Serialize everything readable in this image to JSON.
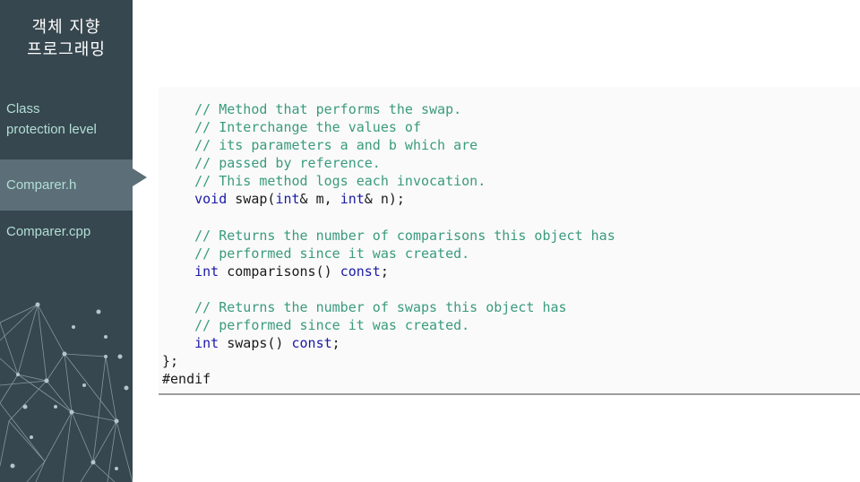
{
  "sidebar": {
    "title_lines": [
      "객체 지향",
      "프로그래밍"
    ],
    "nav": [
      {
        "lines": [
          "Class",
          "protection level"
        ],
        "active": false
      },
      {
        "lines": [
          "Comparer.h"
        ],
        "active": true
      },
      {
        "lines": [
          "Comparer.cpp"
        ],
        "active": false
      }
    ]
  },
  "code": {
    "language": "C++",
    "lines": [
      [
        {
          "t": "    "
        },
        {
          "t": "// Method that performs the swap.",
          "c": "comment"
        }
      ],
      [
        {
          "t": "    "
        },
        {
          "t": "// Interchange the values of",
          "c": "comment"
        }
      ],
      [
        {
          "t": "    "
        },
        {
          "t": "// its parameters a and b which are",
          "c": "comment"
        }
      ],
      [
        {
          "t": "    "
        },
        {
          "t": "// passed by reference.",
          "c": "comment"
        }
      ],
      [
        {
          "t": "    "
        },
        {
          "t": "// This method logs each invocation.",
          "c": "comment"
        }
      ],
      [
        {
          "t": "    "
        },
        {
          "t": "void",
          "c": "keyword"
        },
        {
          "t": " swap("
        },
        {
          "t": "int",
          "c": "keyword"
        },
        {
          "t": "& m, "
        },
        {
          "t": "int",
          "c": "keyword"
        },
        {
          "t": "& n);"
        }
      ],
      [
        {
          "t": ""
        }
      ],
      [
        {
          "t": "    "
        },
        {
          "t": "// Returns the number of comparisons this object has",
          "c": "comment"
        }
      ],
      [
        {
          "t": "    "
        },
        {
          "t": "// performed since it was created.",
          "c": "comment"
        }
      ],
      [
        {
          "t": "    "
        },
        {
          "t": "int",
          "c": "keyword"
        },
        {
          "t": " comparisons() "
        },
        {
          "t": "const",
          "c": "keyword"
        },
        {
          "t": ";"
        }
      ],
      [
        {
          "t": ""
        }
      ],
      [
        {
          "t": "    "
        },
        {
          "t": "// Returns the number of swaps this object has",
          "c": "comment"
        }
      ],
      [
        {
          "t": "    "
        },
        {
          "t": "// performed since it was created.",
          "c": "comment"
        }
      ],
      [
        {
          "t": "    "
        },
        {
          "t": "int",
          "c": "keyword"
        },
        {
          "t": " swaps() "
        },
        {
          "t": "const",
          "c": "keyword"
        },
        {
          "t": ";"
        }
      ],
      [
        {
          "t": "};"
        }
      ],
      [
        {
          "t": "#endif"
        }
      ]
    ]
  },
  "colors": {
    "sidebar_bg": "#37474f",
    "sidebar_active": "#5c6f78",
    "nav_text": "#b2dfd6",
    "comment": "#3a9b7d",
    "keyword": "#1a1aa6"
  }
}
